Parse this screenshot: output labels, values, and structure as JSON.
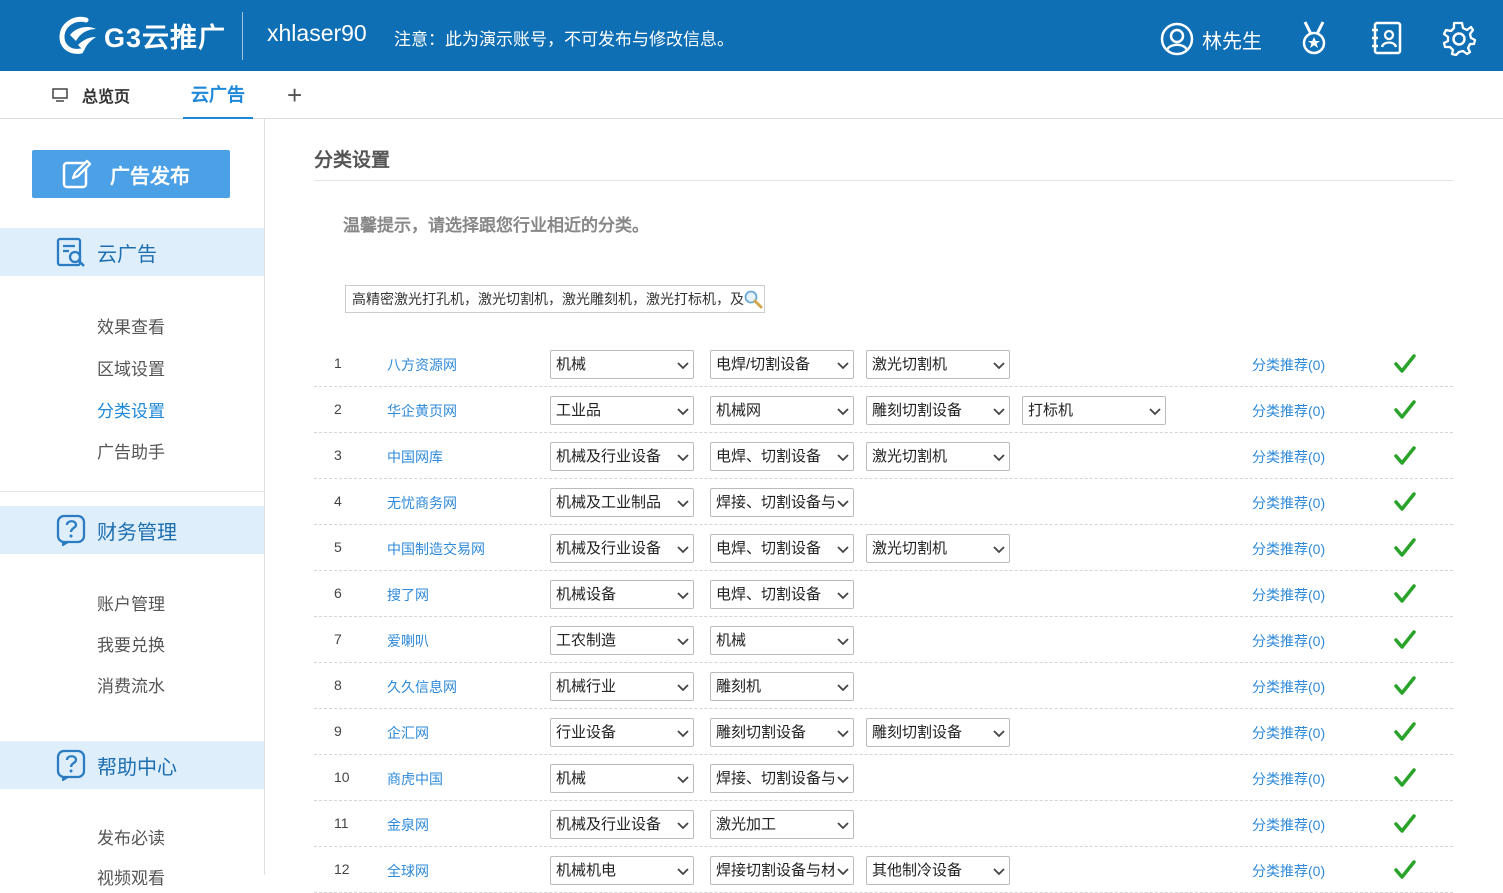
{
  "header": {
    "logo_text": "G3云推广",
    "account": "xhlaser90",
    "notice": "注意：此为演示账号，不可发布与修改信息。",
    "user_name": "林先生"
  },
  "tabs": {
    "home": "总览页",
    "ad": "云广告",
    "add": "+"
  },
  "sidebar": {
    "publish": "广告发布",
    "sections": [
      {
        "title": "云广告",
        "items": [
          "效果查看",
          "区域设置",
          "分类设置",
          "广告助手"
        ],
        "active": "分类设置"
      },
      {
        "title": "财务管理",
        "items": [
          "账户管理",
          "我要兑换",
          "消费流水"
        ]
      },
      {
        "title": "帮助中心",
        "items": [
          "发布必读",
          "视频观看"
        ]
      }
    ]
  },
  "main": {
    "title": "分类设置",
    "tip": "温馨提示，请选择跟您行业相近的分类。",
    "keywords": "高精密激光打孔机，激光切割机，激光雕刻机，激光打标机，及",
    "rows": [
      {
        "num": "1",
        "site": "八方资源网",
        "cats": [
          "机械",
          "电焊/切割设备",
          "激光切割机"
        ],
        "rec": "分类推荐(0)"
      },
      {
        "num": "2",
        "site": "华企黄页网",
        "cats": [
          "工业品",
          "机械网",
          "雕刻切割设备",
          "打标机"
        ],
        "rec": "分类推荐(0)"
      },
      {
        "num": "3",
        "site": "中国网库",
        "cats": [
          "机械及行业设备",
          "电焊、切割设备",
          "激光切割机"
        ],
        "rec": "分类推荐(0)"
      },
      {
        "num": "4",
        "site": "无忧商务网",
        "cats": [
          "机械及工业制品",
          "焊接、切割设备与"
        ],
        "rec": "分类推荐(0)"
      },
      {
        "num": "5",
        "site": "中国制造交易网",
        "cats": [
          "机械及行业设备",
          "电焊、切割设备",
          "激光切割机"
        ],
        "rec": "分类推荐(0)"
      },
      {
        "num": "6",
        "site": "搜了网",
        "cats": [
          "机械设备",
          "电焊、切割设备"
        ],
        "rec": "分类推荐(0)"
      },
      {
        "num": "7",
        "site": "爱喇叭",
        "cats": [
          "工农制造",
          "机械"
        ],
        "rec": "分类推荐(0)"
      },
      {
        "num": "8",
        "site": "久久信息网",
        "cats": [
          "机械行业",
          "雕刻机"
        ],
        "rec": "分类推荐(0)"
      },
      {
        "num": "9",
        "site": "企汇网",
        "cats": [
          "行业设备",
          "雕刻切割设备",
          "雕刻切割设备"
        ],
        "rec": "分类推荐(0)"
      },
      {
        "num": "10",
        "site": "商虎中国",
        "cats": [
          "机械",
          "焊接、切割设备与"
        ],
        "rec": "分类推荐(0)"
      },
      {
        "num": "11",
        "site": "金泉网",
        "cats": [
          "机械及行业设备",
          "激光加工"
        ],
        "rec": "分类推荐(0)"
      },
      {
        "num": "12",
        "site": "全球网",
        "cats": [
          "机械机电",
          "焊接切割设备与材",
          "其他制冷设备"
        ],
        "rec": "分类推荐(0)"
      }
    ]
  },
  "colors": {
    "header_bg": "#0f6fb4",
    "accent": "#1e88d8",
    "link": "#2f8ad9",
    "section_bg": "#dfeefb",
    "publish_bg": "#4ba0e6",
    "check": "#2aa32a"
  }
}
